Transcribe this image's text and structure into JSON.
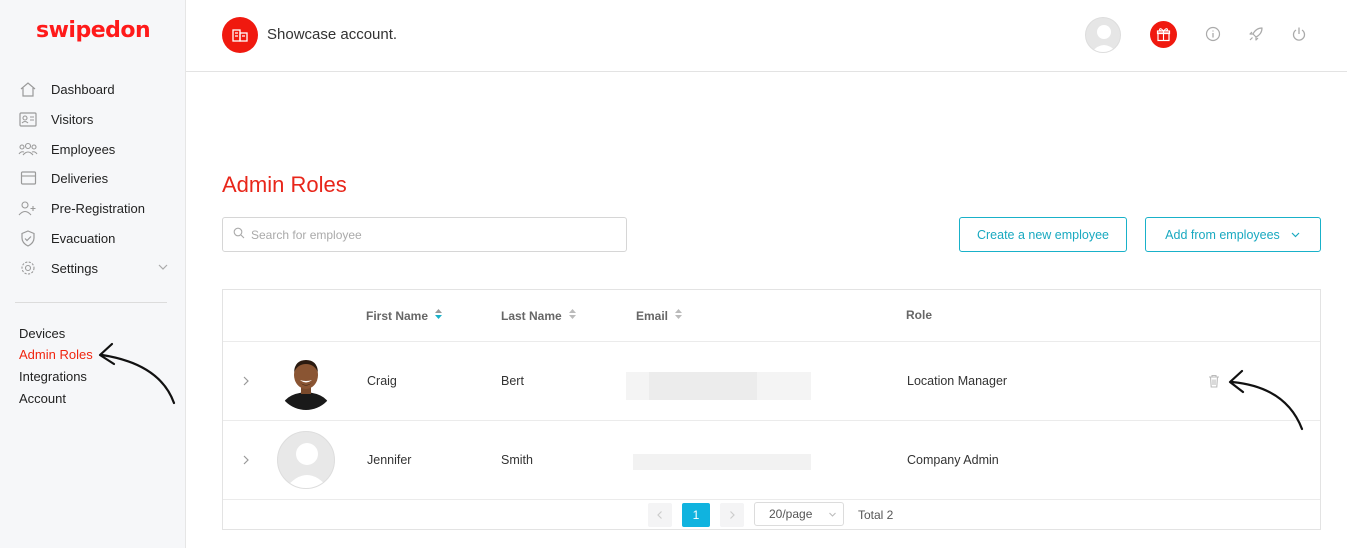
{
  "brand": {
    "logo_text": "swipedon",
    "accent": "#f0190f",
    "link_color": "#19a9c0"
  },
  "sidebar": {
    "items": [
      {
        "label": "Dashboard",
        "icon": "home-icon"
      },
      {
        "label": "Visitors",
        "icon": "id-card-icon"
      },
      {
        "label": "Employees",
        "icon": "people-icon"
      },
      {
        "label": "Deliveries",
        "icon": "package-icon"
      },
      {
        "label": "Pre-Registration",
        "icon": "add-user-icon"
      },
      {
        "label": "Evacuation",
        "icon": "shield-icon"
      },
      {
        "label": "Settings",
        "icon": "gear-icon"
      }
    ],
    "sublinks": [
      "Devices",
      "Admin Roles",
      "Integrations",
      "Account"
    ],
    "active_sublink": "Admin Roles"
  },
  "header": {
    "account_name": "Showcase account."
  },
  "main": {
    "title": "Admin Roles",
    "search_placeholder": "Search for employee",
    "create_button": "Create a new employee",
    "add_button": "Add from employees"
  },
  "table": {
    "columns": [
      "First Name",
      "Last Name",
      "Email",
      "Role"
    ],
    "rows": [
      {
        "first_name": "Craig",
        "last_name": "Bert",
        "email": "",
        "role": "Location Manager"
      },
      {
        "first_name": "Jennifer",
        "last_name": "Smith",
        "email": "",
        "role": "Company Admin"
      }
    ]
  },
  "pagination": {
    "current_page": "1",
    "page_size": "20/page",
    "total": "Total 2"
  }
}
